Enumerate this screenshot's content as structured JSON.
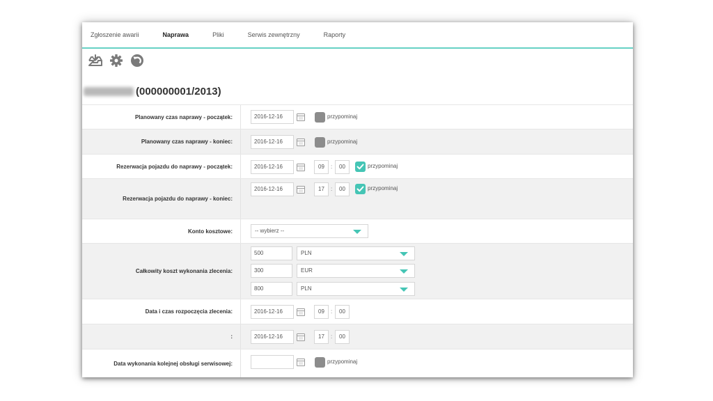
{
  "tabs": [
    {
      "label": "Zgłoszenie awarii"
    },
    {
      "label": "Naprawa"
    },
    {
      "label": "Pliki"
    },
    {
      "label": "Serwis zewnętrzny"
    },
    {
      "label": "Raporty"
    }
  ],
  "active_tab": "Naprawa",
  "toolbar": {
    "icons": [
      "save-tray-icon",
      "gear-icon",
      "undo-icon"
    ]
  },
  "title": {
    "order_number": "(000000001/2013)"
  },
  "accent_color": "#45c5b5",
  "rows": {
    "planned_start": {
      "label": "Planowany czas naprawy - początek:",
      "date": "2016-12-16",
      "remind_label": "przypominaj",
      "remind_checked": false
    },
    "planned_end": {
      "label": "Planowany czas naprawy - koniec:",
      "date": "2016-12-16",
      "remind_label": "przypominaj",
      "remind_checked": false
    },
    "reservation_start": {
      "label": "Rezerwacja pojazdu do naprawy - początek:",
      "date": "2016-12-16",
      "hour": "09",
      "sep": ":",
      "minute": "00",
      "remind_label": "przypominaj",
      "remind_checked": true
    },
    "reservation_end": {
      "label": "Rezerwacja pojazdu do naprawy - koniec:",
      "date": "2016-12-16",
      "hour": "17",
      "sep": ":",
      "minute": "00",
      "remind_label": "przypominaj",
      "remind_checked": true
    },
    "cost_account": {
      "label": "Konto kosztowe:",
      "selected": "-- wybierz --"
    },
    "total_cost": {
      "label": "Całkowity koszt wykonania zlecenia:",
      "items": [
        {
          "amount": "500",
          "currency": "PLN"
        },
        {
          "amount": "300",
          "currency": "EUR"
        },
        {
          "amount": "800",
          "currency": "PLN"
        }
      ]
    },
    "order_start": {
      "label": "Data i czas rozpoczęcia zlecenia:",
      "date": "2016-12-16",
      "hour": "09",
      "sep": ":",
      "minute": "00"
    },
    "order_end": {
      "label": ":",
      "date": "2016-12-16",
      "hour": "17",
      "sep": ":",
      "minute": "00"
    },
    "next_service": {
      "label": "Data wykonania kolejnej obsługi serwisowej:",
      "date": "",
      "remind_label": "przypominaj",
      "remind_checked": false
    }
  }
}
